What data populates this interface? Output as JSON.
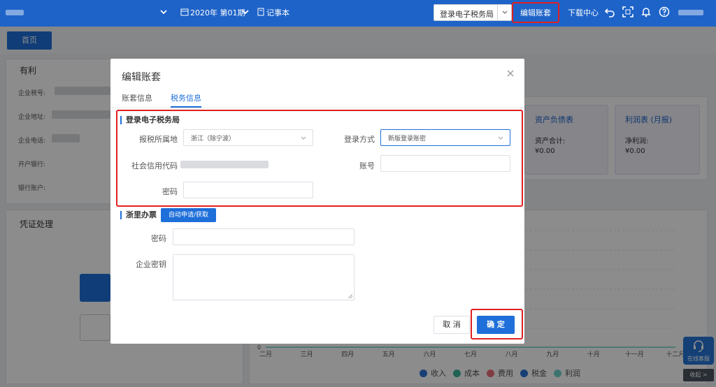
{
  "topbar": {
    "period": "2020年 第01期",
    "notebook": "记事本",
    "login_tax_select": "登录电子税务局",
    "edit_account": "编辑账套",
    "download_center": "下载中心"
  },
  "tabs": {
    "home": "首页"
  },
  "company_panel": {
    "title": "有利",
    "labels": [
      "企业税号:",
      "企业地址:",
      "企业电话:",
      "开户银行:",
      "银行账户:"
    ]
  },
  "voucher_panel": {
    "title": "凭证处理"
  },
  "cards": [
    {
      "title": "资产负债表",
      "label": "资产合计:",
      "value": "¥0.00"
    },
    {
      "title": "利润表 (月报)",
      "label": "净利润:",
      "value": "¥0.00"
    }
  ],
  "chart_data": {
    "type": "line",
    "x": [
      "二月",
      "三月",
      "四月",
      "五月",
      "六月",
      "七月",
      "八月",
      "九月",
      "十月",
      "十一月",
      "十二月"
    ],
    "series": [
      {
        "name": "收入",
        "color": "#2b73d6"
      },
      {
        "name": "成本",
        "color": "#3fb39c"
      },
      {
        "name": "费用",
        "color": "#e8707a"
      },
      {
        "name": "税金",
        "color": "#2b73d6"
      },
      {
        "name": "利润",
        "color": "#6fd1c8"
      }
    ],
    "y_tick": "0"
  },
  "service": {
    "label": "在线客服",
    "collapse": "收起 >"
  },
  "modal": {
    "title": "编辑账套",
    "tabs": [
      "账套信息",
      "税务信息"
    ],
    "section1": {
      "title": "登录电子税务局",
      "tax_location_label": "报税所属地",
      "tax_location_value": "浙江（除宁波）",
      "login_method_label": "登录方式",
      "login_method_value": "新版登录账密",
      "credit_code_label": "社会信用代码",
      "account_label": "账号",
      "password_label": "密码"
    },
    "section2": {
      "title": "浙里办票",
      "auto_button": "自动申请/获取",
      "password_label": "密码",
      "secret_label": "企业密钥"
    },
    "cancel": "取 消",
    "confirm": "确 定"
  }
}
